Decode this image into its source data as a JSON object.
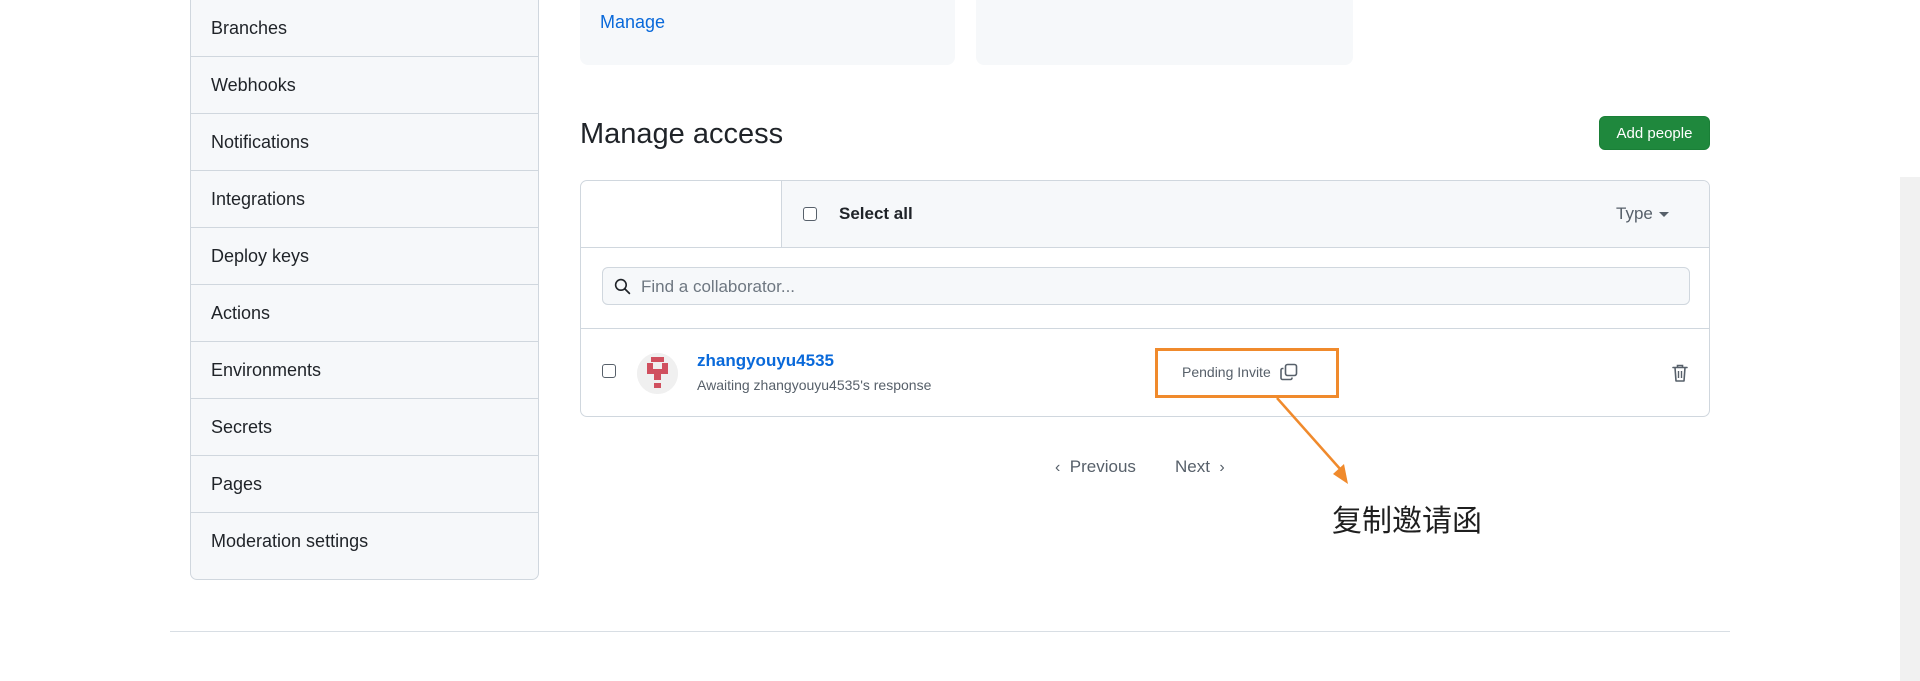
{
  "sidebar": {
    "items": [
      {
        "label": "Branches"
      },
      {
        "label": "Webhooks"
      },
      {
        "label": "Notifications"
      },
      {
        "label": "Integrations"
      },
      {
        "label": "Deploy keys"
      },
      {
        "label": "Actions"
      },
      {
        "label": "Environments"
      },
      {
        "label": "Secrets"
      },
      {
        "label": "Pages"
      },
      {
        "label": "Moderation settings"
      }
    ]
  },
  "top_card": {
    "manage_link": "Manage"
  },
  "manage_access": {
    "title": "Manage access",
    "add_button": "Add people",
    "select_all": "Select all",
    "type_filter": "Type",
    "search_placeholder": "Find a collaborator...",
    "members": [
      {
        "username": "zhangyouyu4535",
        "status_text": "Awaiting zhangyouyu4535's response",
        "invite_label": "Pending Invite"
      }
    ]
  },
  "pagination": {
    "previous": "Previous",
    "next": "Next"
  },
  "annotation": {
    "text": "复制邀请函"
  },
  "colors": {
    "accent_link": "#0969da",
    "primary_button": "#1f883d",
    "highlight": "#f08a2c"
  }
}
